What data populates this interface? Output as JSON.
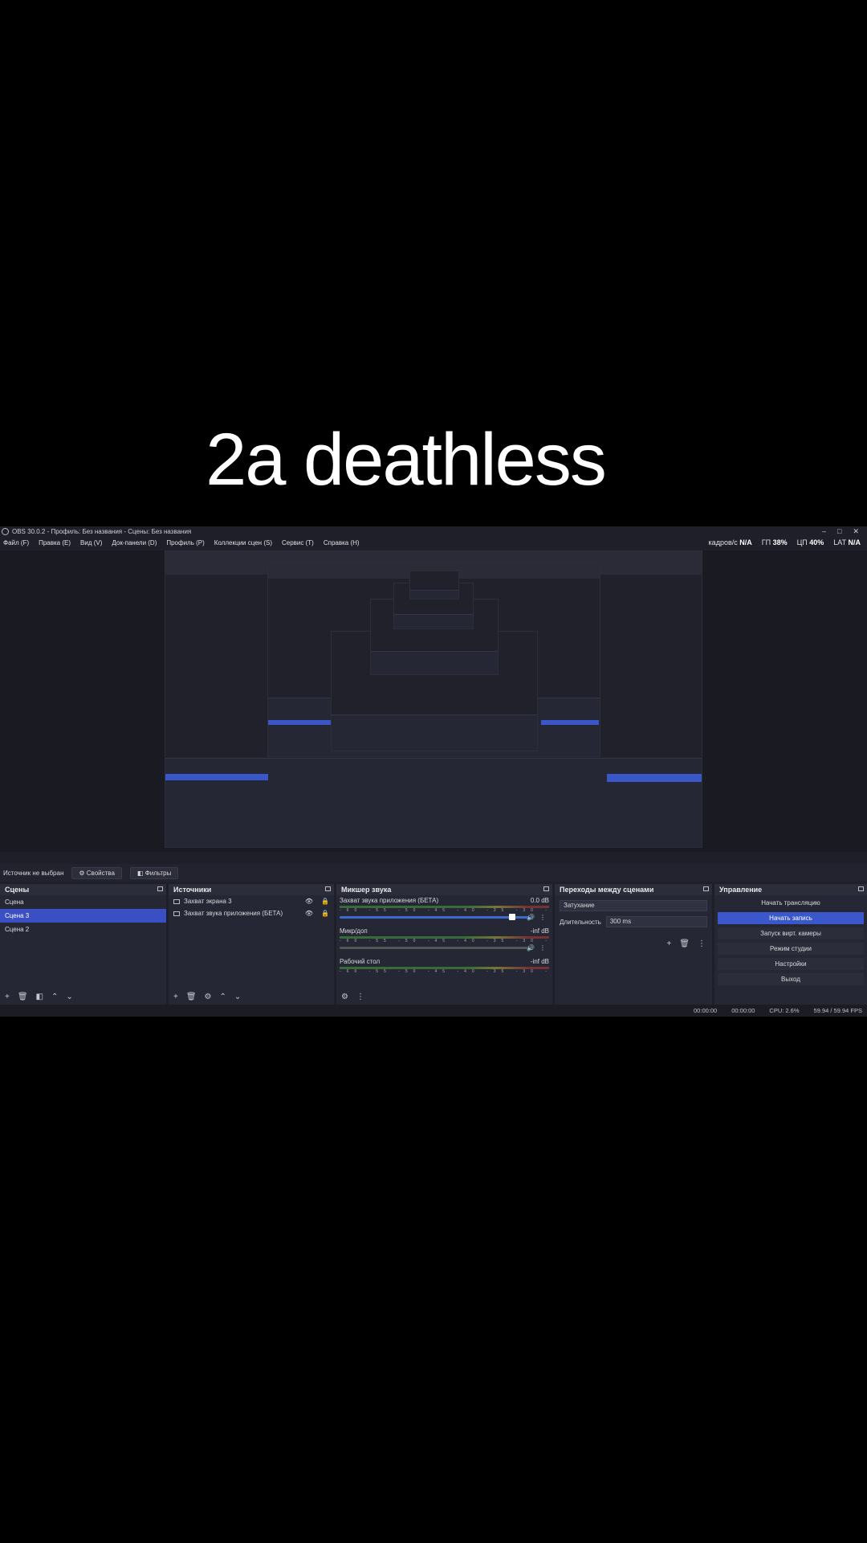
{
  "caption": "2a deathless",
  "window": {
    "title": "OBS 30.0.2 - Профиль: Без названия - Сцены: Без названия"
  },
  "menu": [
    "Файл (F)",
    "Правка (E)",
    "Вид (V)",
    "Док-панели (D)",
    "Профиль (P)",
    "Коллекции сцен (S)",
    "Сервис (T)",
    "Справка (H)"
  ],
  "stats": {
    "fps_label": "кадров/с",
    "fps_value": "N/A",
    "gpu_label": "ГП",
    "gpu_value": "38%",
    "cpu_label": "ЦП",
    "cpu_value": "40%",
    "lat_label": "LAT",
    "lat_value": "N/A"
  },
  "source_bar": {
    "status": "Источник не выбран",
    "properties": "Свойства",
    "filters": "Фильтры"
  },
  "scenes": {
    "title": "Сцены",
    "items": [
      "Сцена",
      "Сцена 3",
      "Сцена 2"
    ],
    "selected_index": 1
  },
  "sources": {
    "title": "Источники",
    "items": [
      "Захват экрана 3",
      "Захват звука приложения (БЕТА)"
    ]
  },
  "mixer": {
    "title": "Микшер звука",
    "channels": [
      {
        "name": "Захват звука приложения (БЕТА)",
        "level": "0.0 dB"
      },
      {
        "name": "Микр/доп",
        "level": "-inf dB"
      },
      {
        "name": "Рабочий стол",
        "level": "-inf dB"
      }
    ],
    "ticks": "-60 -55 -50 -45 -40 -35 -30 -25 -20 -15 -10 -5 0"
  },
  "transitions": {
    "title": "Переходы между сценами",
    "type": "Затухание",
    "duration_label": "Длительность",
    "duration_value": "300 ms"
  },
  "controls": {
    "title": "Управление",
    "buttons": [
      "Начать трансляцию",
      "Начать запись",
      "Запуск вирт. камеры",
      "Режим студии",
      "Настройки",
      "Выход"
    ],
    "active_index": 1
  },
  "status": {
    "stream_time": "00:00:00",
    "rec_time": "00:00:00",
    "cpu": "CPU: 2.6%",
    "fps": "59.94 / 59.94 FPS"
  },
  "icons": {
    "add": "plus-icon",
    "remove": "trash-icon",
    "filter": "filter-icon",
    "up": "chevron-up-icon",
    "down": "chevron-down-icon",
    "eye": "eye-icon",
    "lock": "lock-icon",
    "gear": "gear-icon",
    "more": "more-icon"
  }
}
